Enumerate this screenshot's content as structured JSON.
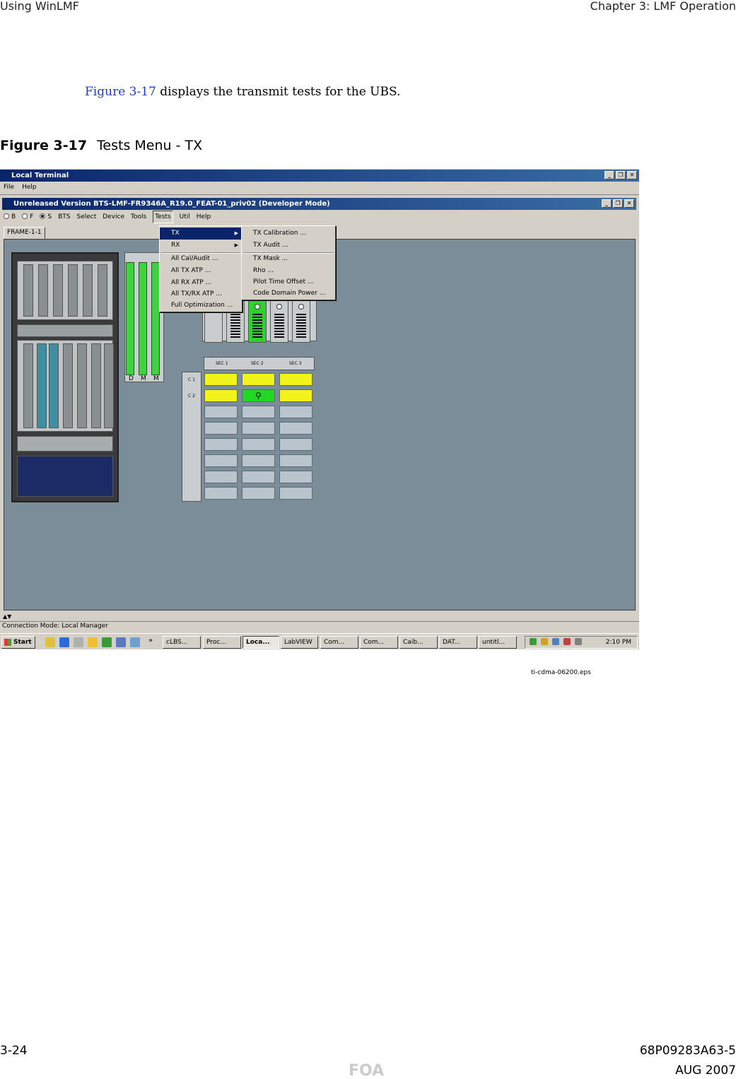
{
  "header": {
    "left": "Using WinLMF",
    "right": "Chapter 3: LMF Operation"
  },
  "intro": {
    "link": "Figure 3-17",
    "rest": " displays the transmit tests for the UBS."
  },
  "figure": {
    "number": "Figure 3-17",
    "title": "Tests Menu - TX",
    "file": "ti-cdma-06200.eps"
  },
  "screenshot": {
    "outer_title": "Local Terminal",
    "outer_menu": [
      "File",
      "Help"
    ],
    "inner_title": "Unreleased Version BTS-LMF-FR9346A_R19.0_FEAT-01_priv02 (Developer Mode)",
    "inner_menu": {
      "radios": [
        "B",
        "F",
        "S"
      ],
      "items": [
        "BTS",
        "Select",
        "Device",
        "Tools",
        "Tests",
        "Util",
        "Help"
      ]
    },
    "tab": "FRAME-1-1",
    "dmm_top": [
      "D",
      "M",
      "M"
    ],
    "dmm_bottom": [
      "D",
      "M",
      "M"
    ],
    "tests_menu": [
      "TX",
      "RX",
      "All Cal/Audit ...",
      "All TX ATP ...",
      "All RX ATP ...",
      "All TX/RX ATP ...",
      "Full Optimization ..."
    ],
    "tx_submenu": [
      "TX Calibration ...",
      "TX Audit ...",
      "TX Mask ...",
      "Rho ...",
      "Pilot Time Offset ...",
      "Code Domain Power ..."
    ],
    "sectors": [
      "SEC 1",
      "SEC 2",
      "SEC 3"
    ],
    "carriers": [
      "C 1",
      "C 2"
    ],
    "status": "Connection Mode: Local Manager",
    "taskbar": {
      "start": "Start",
      "more": "»",
      "buttons": [
        "cLBS...",
        "Proc...",
        "Loca...",
        "LabVIEW",
        "Com...",
        "Com...",
        "Caib...",
        "DAT...",
        "untitl..."
      ],
      "clock": "2:10 PM"
    },
    "colors": {
      "workspace": "#7a8d98",
      "titlebar": "#0a246a",
      "alarm_yellow": "#f2f21d",
      "ok_green": "#22d822"
    }
  },
  "footer": {
    "left": "3-24",
    "right_top": "68P09283A63-5",
    "center": "FOA",
    "right_bottom": "AUG 2007"
  }
}
